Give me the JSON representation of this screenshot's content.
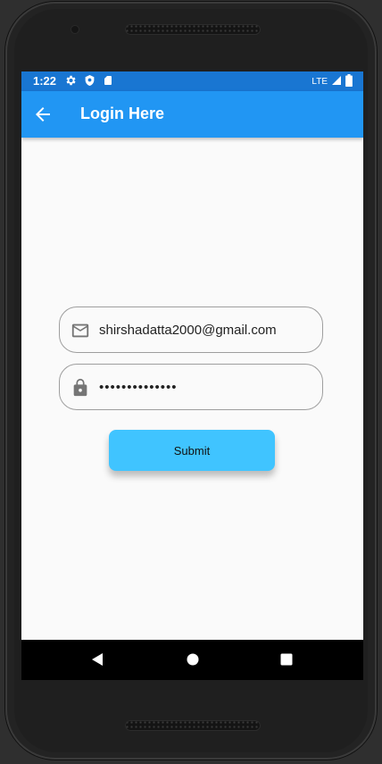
{
  "status_bar": {
    "time": "1:22",
    "network": "LTE",
    "icons": [
      "gear-icon",
      "shield-icon",
      "sd-card-icon",
      "signal-icon",
      "battery-icon"
    ],
    "color": "#1976d2"
  },
  "app_bar": {
    "title": "Login Here",
    "back_icon": "arrow-back-icon",
    "color": "#2196f3"
  },
  "form": {
    "email": {
      "value": "shirshadatta2000@gmail.com",
      "icon": "mail-icon"
    },
    "password": {
      "value": "••••••••••••••",
      "icon": "lock-icon"
    },
    "submit_label": "Submit",
    "submit_color": "#40c4ff"
  },
  "nav_bar": {
    "icons": [
      "nav-back-icon",
      "nav-home-icon",
      "nav-recents-icon"
    ]
  }
}
